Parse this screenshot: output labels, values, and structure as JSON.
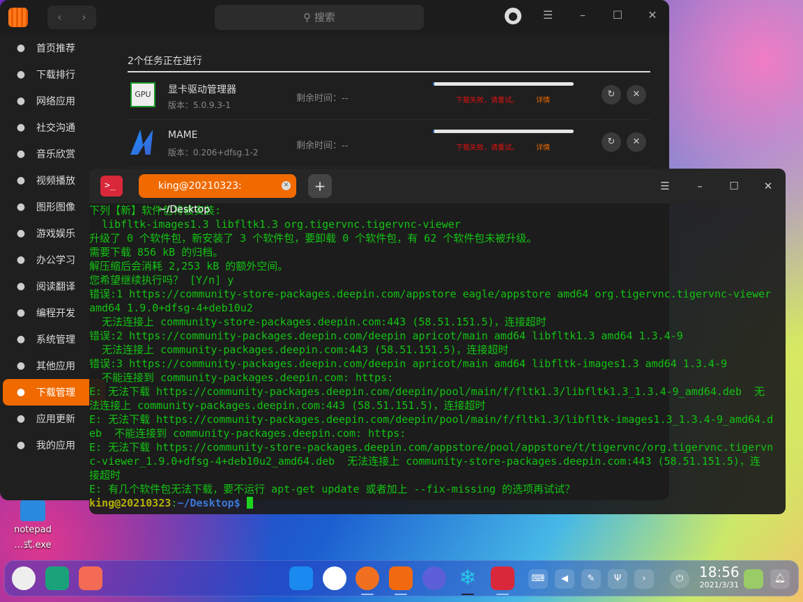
{
  "store": {
    "search_placeholder": "搜索",
    "sidebar": [
      {
        "label": "首页推荐",
        "icon": "star-icon"
      },
      {
        "label": "下载排行",
        "icon": "crown-icon"
      },
      {
        "label": "网络应用",
        "icon": "globe-icon"
      },
      {
        "label": "社交沟通",
        "icon": "chat-icon"
      },
      {
        "label": "音乐欣赏",
        "icon": "music-icon"
      },
      {
        "label": "视频播放",
        "icon": "film-icon"
      },
      {
        "label": "图形图像",
        "icon": "image-icon"
      },
      {
        "label": "游戏娱乐",
        "icon": "gamepad-icon"
      },
      {
        "label": "办公学习",
        "icon": "presentation-icon"
      },
      {
        "label": "阅读翻译",
        "icon": "book-icon"
      },
      {
        "label": "编程开发",
        "icon": "terminal-icon"
      },
      {
        "label": "系统管理",
        "icon": "settings-icon"
      },
      {
        "label": "其他应用",
        "icon": "more-icon"
      },
      {
        "label": "下载管理",
        "icon": "download-icon",
        "active": true
      },
      {
        "label": "应用更新",
        "icon": "refresh-icon"
      },
      {
        "label": "我的应用",
        "icon": "box-icon"
      }
    ],
    "tasks_title": "2个任务正在进行",
    "tasks": [
      {
        "name": "显卡驱动管理器",
        "version": "版本：5.0.9.3-1",
        "remaining": "剩余时间：--",
        "progress": 0,
        "error": "下载失败，请重试。",
        "details": "详情",
        "icon_text": "GPU"
      },
      {
        "name": "MAME",
        "version": "版本：0.206+dfsg.1-2",
        "remaining": "剩余时间：--",
        "progress": 0,
        "error": "下载失败，请重试。",
        "details": "详情"
      }
    ]
  },
  "terminal": {
    "tab_title": "king@20210323: ~/Desktop",
    "lines": [
      "下列【新】软件包将被安装:",
      "  libfltk-images1.3 libfltk1.3 org.tigervnc.tigervnc-viewer",
      "升级了 0 个软件包，新安装了 3 个软件包，要卸载 0 个软件包，有 62 个软件包未被升级。",
      "需要下载 856 kB 的归档。",
      "解压缩后会消耗 2,253 kB 的额外空间。",
      "您希望继续执行吗？ [Y/n] y",
      "错误:1 https://community-store-packages.deepin.com/appstore eagle/appstore amd64 org.tigervnc.tigervnc-viewer",
      "amd64 1.9.0+dfsg-4+deb10u2",
      "  无法连接上 community-store-packages.deepin.com:443 (58.51.151.5)，连接超时",
      "错误:2 https://community-packages.deepin.com/deepin apricot/main amd64 libfltk1.3 amd64 1.3.4-9",
      "  无法连接上 community-packages.deepin.com:443 (58.51.151.5)，连接超时",
      "错误:3 https://community-packages.deepin.com/deepin apricot/main amd64 libfltk-images1.3 amd64 1.3.4-9",
      "  不能连接到 community-packages.deepin.com: https:",
      "E: 无法下载 https://community-packages.deepin.com/deepin/pool/main/f/fltk1.3/libfltk1.3_1.3.4-9_amd64.deb  无",
      "法连接上 community-packages.deepin.com:443 (58.51.151.5)，连接超时",
      "E: 无法下载 https://community-packages.deepin.com/deepin/pool/main/f/fltk1.3/libfltk-images1.3_1.3.4-9_amd64.d",
      "eb  不能连接到 community-packages.deepin.com: https:",
      "E: 无法下载 https://community-store-packages.deepin.com/appstore/pool/appstore/t/tigervnc/org.tigervnc.tigervn",
      "c-viewer_1.9.0+dfsg-4+deb10u2_amd64.deb  无法连接上 community-store-packages.deepin.com:443 (58.51.151.5)，连",
      "接超时",
      "E: 有几个软件包无法下载，要不运行 apt-get update 或者加上 --fix-missing 的选项再试试？"
    ],
    "prompt_user": "king@20210323",
    "prompt_sep": ":",
    "prompt_path": "~/Desktop$"
  },
  "desktop": {
    "icon_label_1": "notepad",
    "icon_label_2": "…式.exe"
  },
  "taskbar": {
    "time": "18:56",
    "date": "2021/3/31"
  }
}
